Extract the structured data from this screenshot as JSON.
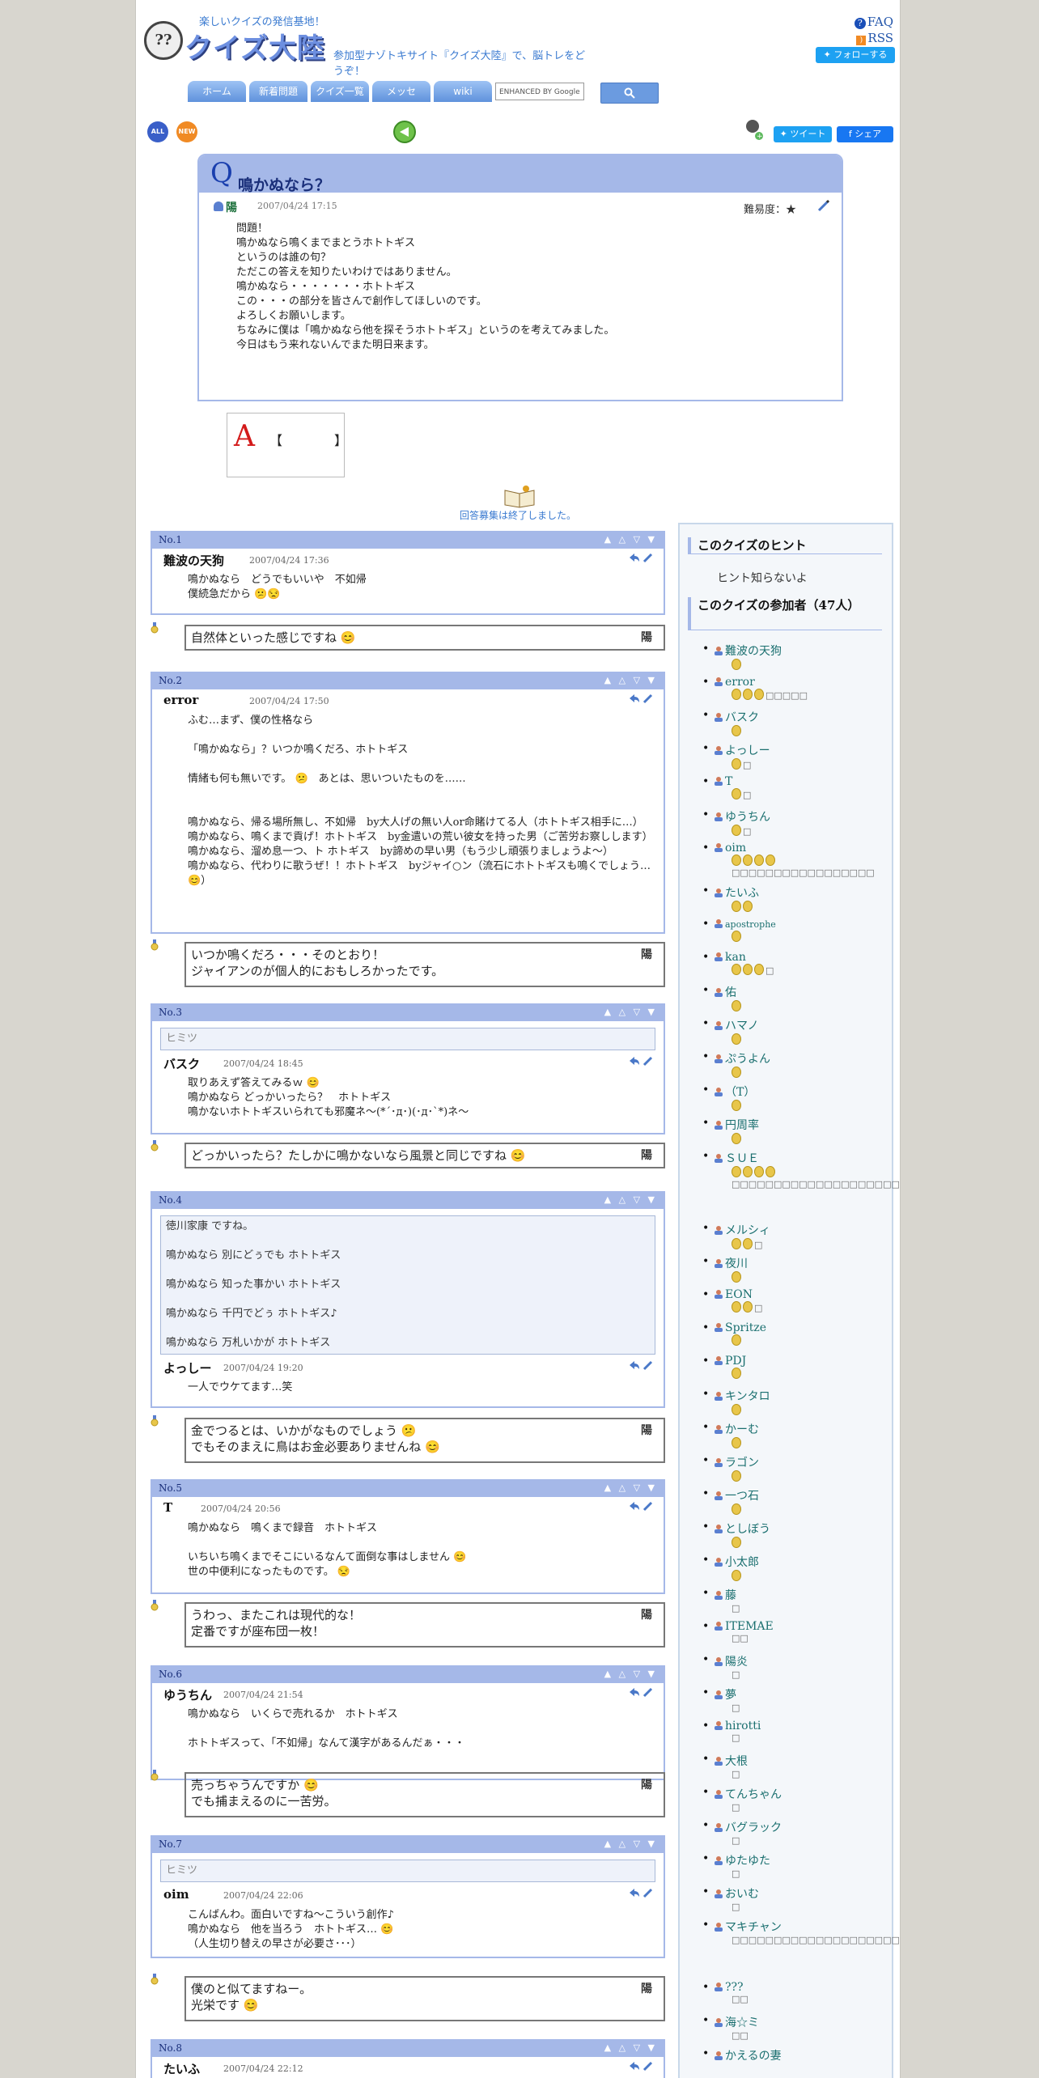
{
  "header": {
    "tagline": "楽しいクイズの発信基地！",
    "logo": "クイズ大陸",
    "subtitle": "参加型ナゾトキサイト『クイズ大陸』で、脳トレをどうぞ！",
    "faq": "FAQ",
    "rss": "RSS",
    "follow": "フォローする"
  },
  "nav": {
    "tabs": [
      "ホーム",
      "新着問題",
      "クイズ一覧",
      "メッセ",
      "wiki"
    ],
    "search_placeholder": "ENHANCED BY Google"
  },
  "toolbar": {
    "all": "ALL",
    "new": "NEW",
    "tweet": "ツイート",
    "share": "シェア"
  },
  "question": {
    "mark": "Q",
    "title": "鳴かぬなら？",
    "author": "陽",
    "date": "2007/04/24 17:15",
    "difficulty_label": "難易度：★",
    "body": [
      "問題！",
      "鳴かぬなら鳴くまでまとうホトトギス",
      "というのは誰の句？",
      "",
      "ただこの答えを知りたいわけではありません。",
      "鳴かぬなら・・・・・・・ホトトギス",
      "この・・・の部分を皆さんで創作してほしいのです。",
      "よろしくお願いします。",
      "",
      "ちなみに僕は「鳴かぬなら他を探そうホトトギス」というのを考えてみました。",
      "",
      "今日はもう来れないんでまた明日来ます。"
    ]
  },
  "answer_box": {
    "mark": "A",
    "brackets": "【　　　　】"
  },
  "closed_text": "回答募集は終了しました。",
  "answers": [
    {
      "no": "No.1",
      "user": "難波の天狗",
      "date": "2007/04/24 17:36",
      "body": [
        "鳴かぬなら　どうでもいいや　不如帰",
        "僕続急だから 😕😒"
      ],
      "reply": [
        "自然体といった感じですね 😊"
      ],
      "reply_by": "陽"
    },
    {
      "no": "No.2",
      "user": "error",
      "date": "2007/04/24 17:50",
      "body": [
        "ふむ…まず、僕の性格なら",
        "",
        "「鳴かぬなら」？いつか鳴くだろ、ホトトギス",
        "",
        "情緒も何も無いです。 😕　あとは、思いついたものを……",
        "",
        "",
        "鳴かぬなら、帰る場所無し、不如帰　by大人げの無い人or命賭けてる人（ホトトギス相手に…）",
        "鳴かぬなら、鳴くまで貢げ！ホトトギス　by金遣いの荒い彼女を持った男（ご苦労お察しします）",
        "鳴かぬなら、溜め息一つ、ト ホトギス　by諦めの早い男（もう少し頑張りましょうよ～）",
        "鳴かぬなら、代わりに歌うぜ！！ホトトギス　byジャイ○ン（流石にホトトギスも鳴くでしょう…😊）"
      ],
      "reply": [
        "いつか鳴くだろ・・・そのとおり！",
        "ジャイアンのが個人的におもしろかったです。"
      ],
      "reply_by": "陽"
    },
    {
      "no": "No.3",
      "hint": "ヒミツ",
      "user": "バスク",
      "date": "2007/04/24 18:45",
      "body": [
        "取りあえず答えてみるｗ 😊",
        "鳴かぬなら どっかいったら？　ホトトギス",
        "鳴かないホトトギスいられても邪魔ネ～(*´･д･)(･д･`*)ネ～"
      ],
      "reply": [
        "どっかいったら？たしかに鳴かないなら風景と同じですね 😊"
      ],
      "reply_by": "陽"
    },
    {
      "no": "No.4",
      "quote": [
        "徳川家康 ですね。",
        "",
        "鳴かぬなら 別にどぅでも ホトトギス",
        "",
        "鳴かぬなら 知った事かい ホトトギス",
        "",
        "鳴かぬなら 千円でどぅ ホトトギス♪",
        "",
        "鳴かぬなら 万札いかが ホトトギス"
      ],
      "user": "よっしー",
      "date": "2007/04/24 19:20",
      "body": [
        "一人でウケてます…笑"
      ],
      "reply": [
        "金でつるとは、いかがなものでしょう 😕",
        "でもそのまえに鳥はお金必要ありませんね 😊"
      ],
      "reply_by": "陽"
    },
    {
      "no": "No.5",
      "user": "T",
      "date": "2007/04/24 20:56",
      "body": [
        "鳴かぬなら　鳴くまで録音　ホトトギス",
        "",
        "いちいち鳴くまでそこにいるなんて面倒な事はしません 😊",
        "世の中便利になったものです。 😒"
      ],
      "reply": [
        "うわっ、またこれは現代的な！",
        "定番ですが座布団一枚！"
      ],
      "reply_by": "陽"
    },
    {
      "no": "No.6",
      "user": "ゆうちん",
      "date": "2007/04/24 21:54",
      "body": [
        "鳴かぬなら　いくらで売れるか　ホトトギス",
        "",
        "ホトトギスって、「不如帰」なんて漢字があるんだぁ・・・"
      ],
      "reply": [
        "売っちゃうんですか 😊",
        "でも捕まえるのに一苦労。"
      ],
      "reply_by": "陽"
    },
    {
      "no": "No.7",
      "hint": "ヒミツ",
      "user": "oim",
      "date": "2007/04/24 22:06",
      "body": [
        "こんばんわ。面白いですね～こういう創作♪",
        "鳴かぬなら　他を当ろう　ホトトギス… 😊",
        "（人生切り替えの早さが必要さ･･･）"
      ],
      "reply": [
        "僕のと似てますねー。",
        "光栄です 😊"
      ],
      "reply_by": "陽"
    },
    {
      "no": "No.8",
      "user": "たいふ",
      "date": "2007/04/24 22:12",
      "body": [],
      "reply": [],
      "reply_by": ""
    }
  ],
  "answer_arrows": "▲ △ ▽ ▼",
  "sidebar": {
    "hint_title": "このクイズのヒント",
    "hint_text": "ヒント知らないよ",
    "participants_title": "このクイズの参加者（47人）",
    "participants": [
      {
        "name": "難波の天狗",
        "medals": 1,
        "extra": ""
      },
      {
        "name": "error",
        "medals": 3,
        "extra": "□□□□□"
      },
      {
        "name": "バスク",
        "medals": 1,
        "extra": ""
      },
      {
        "name": "よっしー",
        "medals": 1,
        "extra": "□"
      },
      {
        "name": "T",
        "medals": 1,
        "extra": "□"
      },
      {
        "name": "ゆうちん",
        "medals": 1,
        "extra": "□"
      },
      {
        "name": "oim",
        "medals": 4,
        "extra": "□□□□□□□□□□□□□□□□□"
      },
      {
        "name": "たいふ",
        "medals": 2,
        "extra": ""
      },
      {
        "name": "apostrophe",
        "medals": 1,
        "extra": ""
      },
      {
        "name": "kan",
        "medals": 3,
        "extra": "□"
      },
      {
        "name": "佑",
        "medals": 1,
        "extra": ""
      },
      {
        "name": "ハマノ",
        "medals": 1,
        "extra": ""
      },
      {
        "name": "ぷうよん",
        "medals": 1,
        "extra": ""
      },
      {
        "name": "（T）",
        "medals": 1,
        "extra": ""
      },
      {
        "name": "円周率",
        "medals": 1,
        "extra": ""
      },
      {
        "name": "ＳＵＥ",
        "medals": 4,
        "extra": "□□□□□□□□□□□□□□□□□□□□□□□□□□□□□□□□□□□□□□□□□□□□□□□□□□□□□□□□□"
      },
      {
        "name": "メルシィ",
        "medals": 2,
        "extra": "□"
      },
      {
        "name": "夜川",
        "medals": 1,
        "extra": ""
      },
      {
        "name": "EON",
        "medals": 2,
        "extra": "□"
      },
      {
        "name": "Spritze",
        "medals": 1,
        "extra": ""
      },
      {
        "name": "PDJ",
        "medals": 1,
        "extra": ""
      },
      {
        "name": "キンタロ",
        "medals": 1,
        "extra": ""
      },
      {
        "name": "かーむ",
        "medals": 1,
        "extra": ""
      },
      {
        "name": "ラゴン",
        "medals": 1,
        "extra": ""
      },
      {
        "name": "一つ石",
        "medals": 1,
        "extra": ""
      },
      {
        "name": "としぼう",
        "medals": 1,
        "extra": ""
      },
      {
        "name": "小太郎",
        "medals": 1,
        "extra": ""
      },
      {
        "name": "藤",
        "medals": 0,
        "extra": "□"
      },
      {
        "name": "ITEMAE",
        "medals": 0,
        "extra": "□□"
      },
      {
        "name": "陽炎",
        "medals": 0,
        "extra": "□"
      },
      {
        "name": "夢",
        "medals": 0,
        "extra": "□"
      },
      {
        "name": "hirotti",
        "medals": 0,
        "extra": "□"
      },
      {
        "name": "大根",
        "medals": 0,
        "extra": "□"
      },
      {
        "name": "てんちゃん",
        "medals": 0,
        "extra": "□"
      },
      {
        "name": "バグラック",
        "medals": 0,
        "extra": "□"
      },
      {
        "name": "ゆたゆた",
        "medals": 0,
        "extra": "□"
      },
      {
        "name": "おいむ",
        "medals": 0,
        "extra": "□"
      },
      {
        "name": "マキチャン",
        "medals": 0,
        "extra": "□□□□□□□□□□□□□□□□□□□□□□□□□□□□□□□□□□□□□□□□"
      },
      {
        "name": "???",
        "medals": 0,
        "extra": "□□"
      },
      {
        "name": "海☆ミ",
        "medals": 0,
        "extra": "□□"
      },
      {
        "name": "かえるの妻",
        "medals": 0,
        "extra": ""
      }
    ]
  },
  "colors": {
    "accent": "#a5b8e8",
    "link": "#3a7ad0",
    "name": "#1a6f6f",
    "medal": "#e8c64a"
  }
}
